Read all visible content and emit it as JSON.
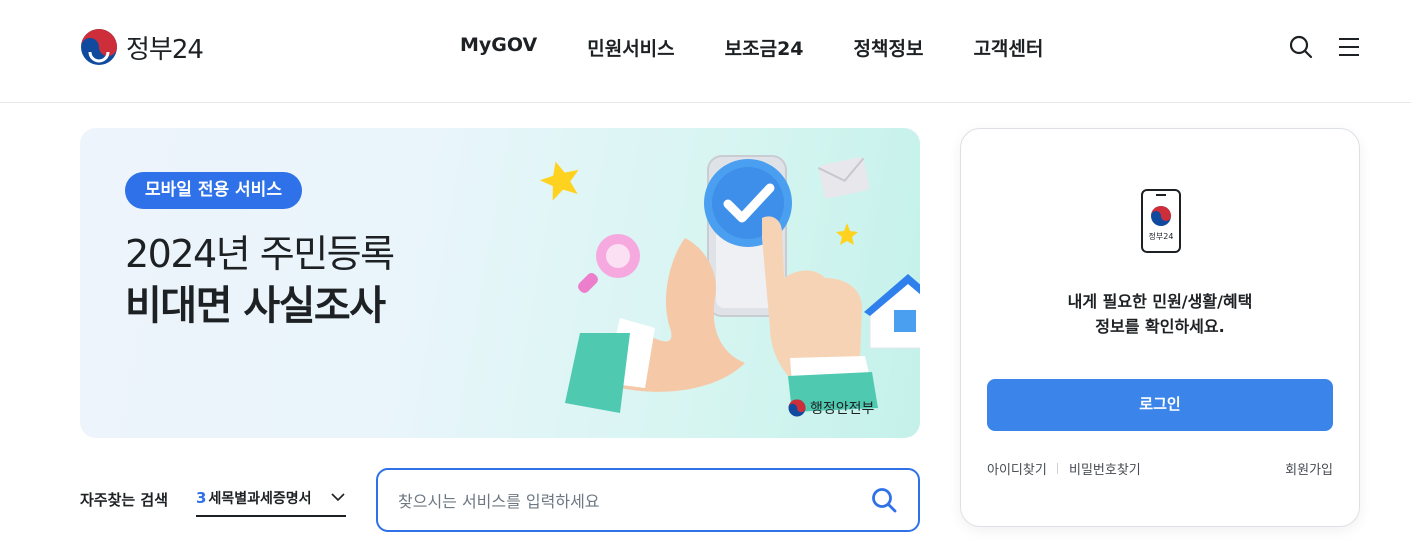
{
  "header": {
    "logo_text": "정부24",
    "nav": [
      "MyGOV",
      "민원서비스",
      "보조금24",
      "정책정보",
      "고객센터"
    ],
    "icons": [
      "search-icon",
      "menu-icon"
    ]
  },
  "banner": {
    "badge": "모바일 전용 서비스",
    "title_line1": "2024년 주민등록",
    "title_line2": "비대면 사실조사",
    "ministry": "행정안전부"
  },
  "search": {
    "fav_label": "자주찾는 검색",
    "fav_rank": "3",
    "fav_value": "세목별과세증명서",
    "placeholder": "찾으시는 서비스를 입력하세요"
  },
  "login": {
    "phone_text": "정부24",
    "message_line1": "내게 필요한 민원/생활/혜택",
    "message_line2": "정보를 확인하세요.",
    "button": "로그인",
    "find_id": "아이디찾기",
    "find_pw": "비밀번호찾기",
    "signup": "회원가입"
  },
  "colors": {
    "accent": "#2f71e8",
    "login_button": "#3b84ea",
    "taegeuk_red": "#cd2e3a",
    "taegeuk_blue": "#0f4a9e"
  }
}
